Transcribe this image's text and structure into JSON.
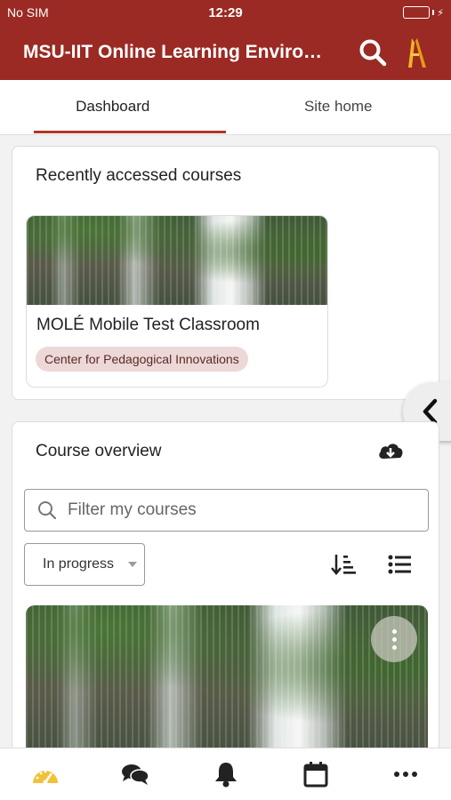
{
  "status_bar": {
    "carrier": "No SIM",
    "time": "12:29"
  },
  "app_bar": {
    "title": "MSU-IIT Online Learning Environ..."
  },
  "tabs": [
    {
      "label": "Dashboard",
      "active": true
    },
    {
      "label": "Site home",
      "active": false
    }
  ],
  "recent": {
    "title": "Recently accessed courses",
    "course": {
      "name": "MOLÉ Mobile Test Classroom",
      "category": "Center for Pedagogical Innovations"
    }
  },
  "overview": {
    "title": "Course overview",
    "filter_placeholder": "Filter my courses",
    "status_filter": "In progress"
  },
  "colors": {
    "brand": "#9a2a23",
    "active_tab": "#b23428",
    "category_bg": "#ecd8d7",
    "battery": "#6fd65a"
  },
  "icons": [
    "search-icon",
    "logo-icon",
    "chevron-left-icon",
    "cloud-download-icon",
    "magnifier-icon",
    "sort-icon",
    "list-icon",
    "more-vertical-icon",
    "dashboard-icon",
    "chat-icon",
    "bell-icon",
    "calendar-icon",
    "more-horizontal-icon"
  ]
}
